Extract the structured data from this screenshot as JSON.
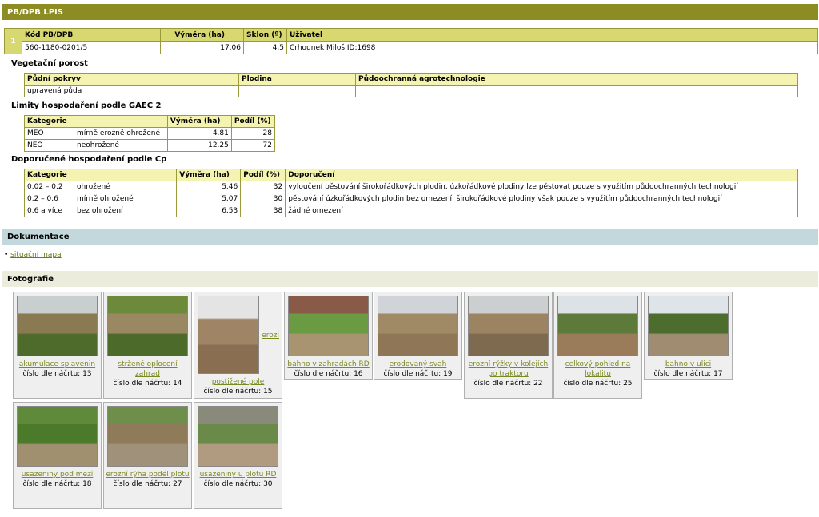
{
  "header": {
    "title": "PB/DPB LPIS"
  },
  "main": {
    "index": "1",
    "columns": [
      "Kód PB/DPB",
      "Výměra (ha)",
      "Sklon (º)",
      "Uživatel"
    ],
    "row": {
      "kod": "560-1180-0201/5",
      "vymera": "17.06",
      "sklon": "4.5",
      "uzivatel": "Crhounek Miloš ID:1698"
    }
  },
  "vegetace": {
    "heading": "Vegetační porost",
    "columns": [
      "Půdní pokryv",
      "Plodina",
      "Půdoochranná agrotechnologie"
    ],
    "row": [
      "upravená půda",
      "",
      ""
    ]
  },
  "gaec": {
    "heading": "Limity hospodaření podle GAEC 2",
    "columns": [
      "Kategorie",
      "Výměra (ha)",
      "Podíl (%)"
    ],
    "rows": [
      [
        "MEO",
        "mírně erozně ohrožené",
        "4.81",
        "28"
      ],
      [
        "NEO",
        "neohrožené",
        "12.25",
        "72"
      ]
    ]
  },
  "cp": {
    "heading": "Doporučené hospodaření podle Cp",
    "columns": [
      "Kategorie",
      "Výměra (ha)",
      "Podíl (%)",
      "Doporučení"
    ],
    "rows": [
      [
        "0.02 – 0.2",
        "ohrožené",
        "5.46",
        "32",
        "vyloučení pěstování širokořádkových plodin, úzkořádkové plodiny lze pěstovat pouze s využitím půdoochranných technologií"
      ],
      [
        "0.2 – 0.6",
        "mírně ohrožené",
        "5.07",
        "30",
        "pěstování úzkořádkových plodin bez omezení, širokořádkové plodiny však pouze s využitím půdoochranných technologií"
      ],
      [
        "0.6 a více",
        "bez ohrožení",
        "6.53",
        "38",
        "žádné omezení"
      ]
    ]
  },
  "dokumentace": {
    "heading": "Dokumentace",
    "link": "situační mapa"
  },
  "fotografie": {
    "heading": "Fotografie",
    "number_prefix": "číslo dle náčrtu:",
    "items": [
      {
        "caption": "akumulace splavenin",
        "number": "13",
        "colors": [
          "#c9cfcf",
          "#8a7a52",
          "#4f6b2c"
        ]
      },
      {
        "caption": "stržené oplocení zahrad",
        "number": "14",
        "colors": [
          "#6c8a3a",
          "#9a8862",
          "#4c6a2a"
        ]
      },
      {
        "caption": "postižené pole",
        "side_label": "erozí",
        "number": "15",
        "colors": [
          "#e4e4e4",
          "#a08466",
          "#8a6e52"
        ]
      },
      {
        "caption": "bahno v zahradách RD",
        "number": "16",
        "colors": [
          "#8a5a48",
          "#6a9a42",
          "#a89470"
        ]
      },
      {
        "caption": "erodovaný svah",
        "number": "19",
        "colors": [
          "#d0d4d8",
          "#a08a66",
          "#8e7656"
        ]
      },
      {
        "caption": "erozní rýžky v kolejích po traktoru",
        "number": "22",
        "colors": [
          "#cccfd0",
          "#9c8462",
          "#7e6a4e"
        ]
      },
      {
        "caption": "celkový pohled na lokalitu",
        "number": "25",
        "colors": [
          "#dde2e6",
          "#5d7a3a",
          "#9a7c5a"
        ]
      },
      {
        "caption": "bahno v ulici",
        "number": "17",
        "colors": [
          "#dfe4e8",
          "#4d6d2e",
          "#a08c70"
        ]
      },
      {
        "caption": "usazeniny pod mezí",
        "number": "18",
        "colors": [
          "#5f8a3a",
          "#4a7a2a",
          "#a09070"
        ]
      },
      {
        "caption": "erozní rýha podél plotu",
        "number": "27",
        "colors": [
          "#6e8f4c",
          "#8f7a5a",
          "#a0927a"
        ]
      },
      {
        "caption": "usazeniny u plotu RD",
        "number": "30",
        "colors": [
          "#8a8a7a",
          "#6a8a4a",
          "#b09a80"
        ]
      }
    ]
  }
}
